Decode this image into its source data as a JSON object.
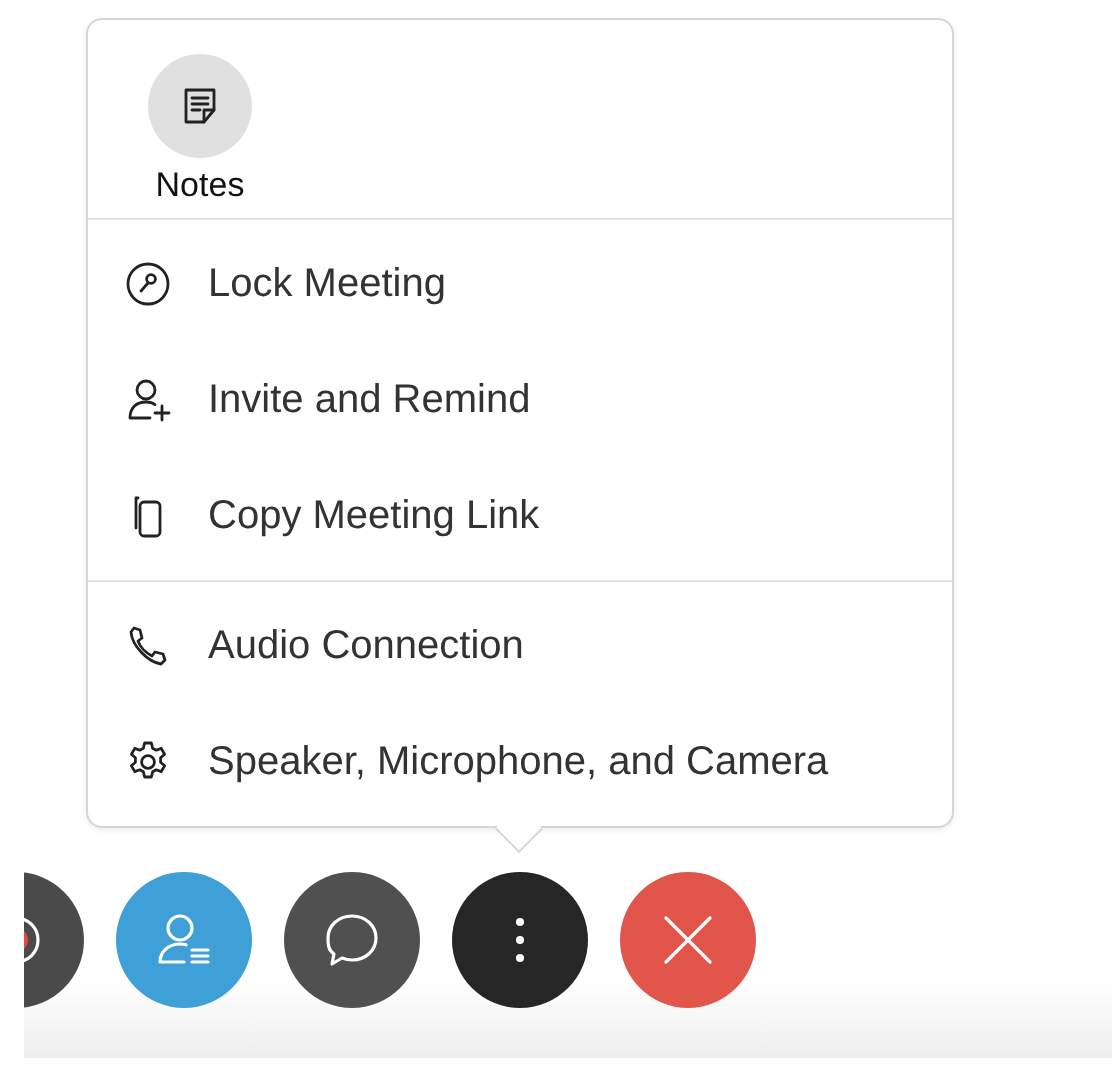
{
  "menu": {
    "tiles": [
      {
        "kind": "notes",
        "label": "Notes"
      }
    ],
    "groups": [
      {
        "items": [
          {
            "kind": "lock",
            "label": "Lock Meeting"
          },
          {
            "kind": "invite",
            "label": "Invite and Remind"
          },
          {
            "kind": "copy",
            "label": "Copy Meeting Link"
          }
        ]
      },
      {
        "items": [
          {
            "kind": "phone",
            "label": "Audio Connection"
          },
          {
            "kind": "gear",
            "label": "Speaker, Microphone, and Camera"
          }
        ]
      }
    ]
  },
  "toolbar": [
    {
      "kind": "record"
    },
    {
      "kind": "participants"
    },
    {
      "kind": "chat"
    },
    {
      "kind": "more"
    },
    {
      "kind": "leave"
    }
  ]
}
